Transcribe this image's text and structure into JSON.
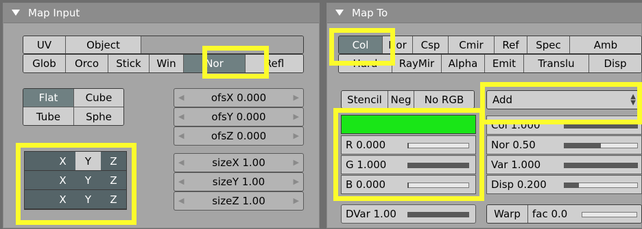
{
  "map_input": {
    "title": "Map Input",
    "row1": [
      "UV",
      "Object"
    ],
    "row2": [
      "Glob",
      "Orco",
      "Stick",
      "Win",
      "Nor",
      "Refl"
    ],
    "proj": [
      "Flat",
      "Cube",
      "Tube",
      "Sphe"
    ],
    "ofs": [
      "ofsX 0.000",
      "ofsY 0.000",
      "ofsZ 0.000"
    ],
    "size": [
      "sizeX 1.00",
      "sizeY 1.00",
      "sizeZ 1.00"
    ],
    "xyz_labels": [
      "X",
      "Y",
      "Z"
    ]
  },
  "map_to": {
    "title": "Map To",
    "row1": [
      "Col",
      "Nor",
      "Csp",
      "Cmir",
      "Ref",
      "Spec",
      "Amb"
    ],
    "row2": [
      "Hard",
      "RayMir",
      "Alpha",
      "Emit",
      "Translu",
      "Disp"
    ],
    "stencil": [
      "Stencil",
      "Neg",
      "No RGB"
    ],
    "blend_mode": "Add",
    "color_hex": "#19e617",
    "rgb": [
      {
        "label": "R 0.000",
        "value": 0.0
      },
      {
        "label": "G 1.000",
        "value": 1.0
      },
      {
        "label": "B 0.000",
        "value": 0.0
      }
    ],
    "factors": [
      {
        "label": "Col 1.000",
        "value": 1.0
      },
      {
        "label": "Nor 0.50",
        "value": 0.5
      },
      {
        "label": "Var 1.000",
        "value": 1.0
      },
      {
        "label": "Disp 0.200",
        "value": 0.2
      }
    ],
    "dvar": {
      "label": "DVar 1.00",
      "value": 1.0
    },
    "warp": "Warp",
    "fac": {
      "label": "fac 0.0",
      "value": 0.0
    }
  },
  "colors": {
    "highlight": "#fcfc2c",
    "selected": "#6f8082"
  }
}
